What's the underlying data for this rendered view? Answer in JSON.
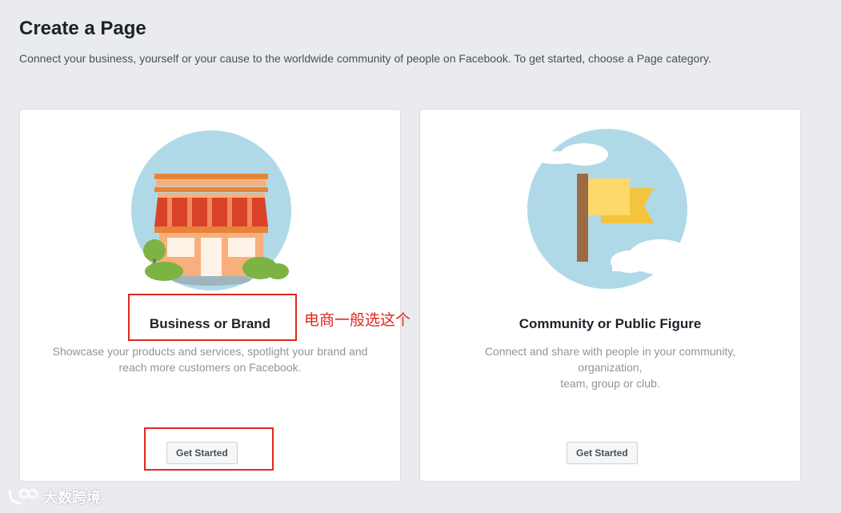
{
  "header": {
    "title": "Create a Page",
    "description": "Connect your business, yourself or your cause to the worldwide community of people on Facebook. To get started, choose a Page category."
  },
  "cards": [
    {
      "title": "Business or Brand",
      "description_line1": "Showcase your products and services, spotlight your brand and",
      "description_line2": "reach more customers on Facebook.",
      "button_label": "Get Started",
      "illustration_icon": "storefront-icon"
    },
    {
      "title": "Community or Public Figure",
      "description_line1": "Connect and share with people in your community, organization,",
      "description_line2": "team, group or club.",
      "button_label": "Get Started",
      "illustration_icon": "flag-icon"
    }
  ],
  "annotation": {
    "note": "电商一般选这个",
    "color": "#e0281f"
  },
  "watermark": {
    "text": "大数跨境"
  }
}
